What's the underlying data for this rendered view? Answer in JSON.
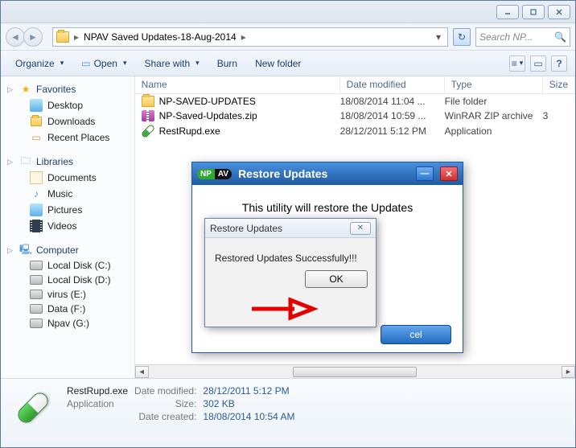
{
  "titlebar": {
    "min": "—",
    "max": "□",
    "close": "✕"
  },
  "address": {
    "crumb_root": "",
    "crumb_main": "NPAV Saved Updates-18-Aug-2014",
    "refresh": "↻"
  },
  "search": {
    "placeholder": "Search NP...",
    "icon": "🔍"
  },
  "toolbar": {
    "organize": "Organize",
    "open": "Open",
    "share": "Share with",
    "burn": "Burn",
    "newfolder": "New folder"
  },
  "nav": {
    "favorites": {
      "label": "Favorites",
      "items": [
        {
          "label": "Desktop"
        },
        {
          "label": "Downloads"
        },
        {
          "label": "Recent Places"
        }
      ]
    },
    "libraries": {
      "label": "Libraries",
      "items": [
        {
          "label": "Documents"
        },
        {
          "label": "Music"
        },
        {
          "label": "Pictures"
        },
        {
          "label": "Videos"
        }
      ]
    },
    "computer": {
      "label": "Computer",
      "items": [
        {
          "label": "Local Disk (C:)"
        },
        {
          "label": "Local Disk (D:)"
        },
        {
          "label": "virus (E:)"
        },
        {
          "label": "Data (F:)"
        },
        {
          "label": "Npav (G:)"
        }
      ]
    }
  },
  "columns": {
    "name": "Name",
    "date": "Date modified",
    "type": "Type",
    "size": "Size"
  },
  "rows": [
    {
      "name": "NP-SAVED-UPDATES",
      "date": "18/08/2014 11:04 ...",
      "type": "File folder",
      "size": ""
    },
    {
      "name": "NP-Saved-Updates.zip",
      "date": "18/08/2014 10:59 ...",
      "type": "WinRAR ZIP archive",
      "size": "3"
    },
    {
      "name": "RestRupd.exe",
      "date": "28/12/2011 5:12 PM",
      "type": "Application",
      "size": ""
    }
  ],
  "details": {
    "name": "RestRupd.exe",
    "type": "Application",
    "lbl_modified": "Date modified:",
    "val_modified": "28/12/2011 5:12 PM",
    "lbl_size": "Size:",
    "val_size": "302 KB",
    "lbl_created": "Date created:",
    "val_created": "18/08/2014 10:54 AM"
  },
  "modal1": {
    "np": "NP",
    "av": "AV",
    "title": "Restore Updates",
    "message": "This utility will restore the Updates",
    "cancel": "cel"
  },
  "modal2": {
    "title": "Restore Updates",
    "message": "Restored Updates Successfully!!!",
    "ok": "OK"
  }
}
